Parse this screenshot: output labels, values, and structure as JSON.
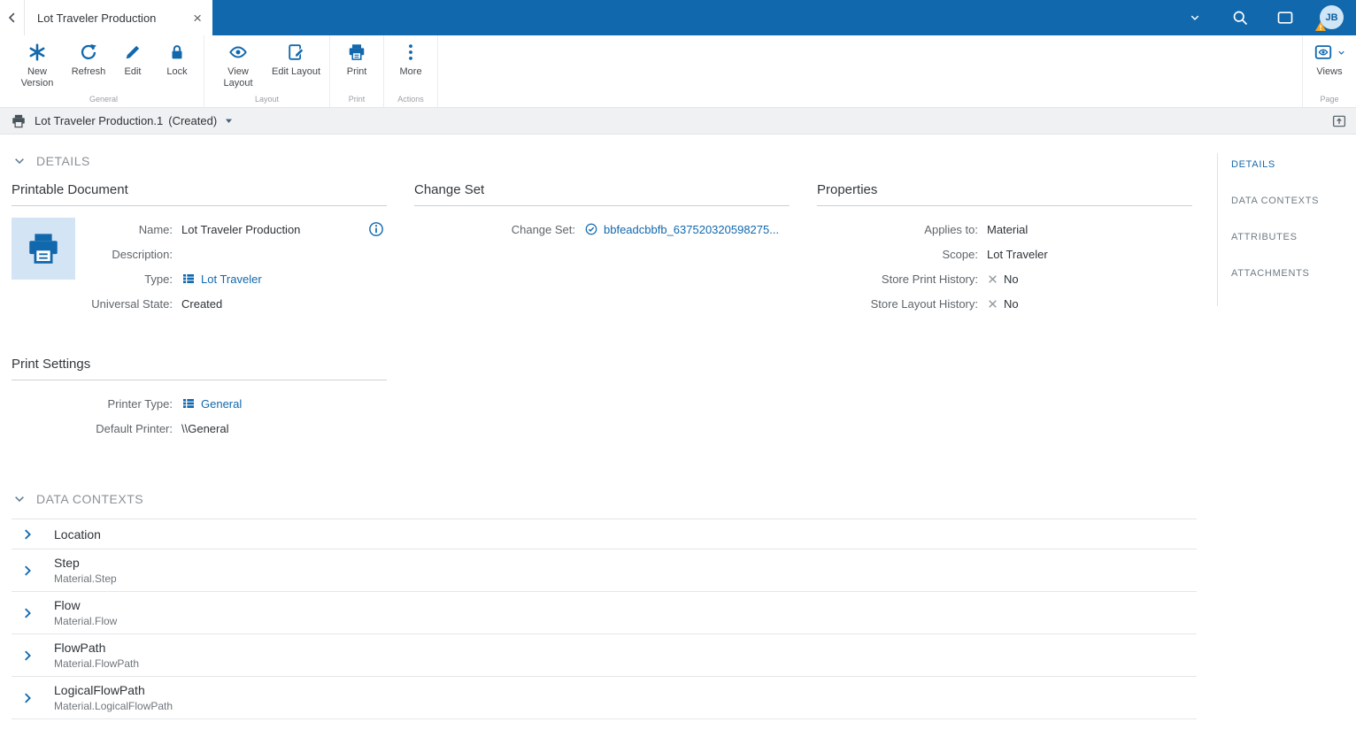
{
  "colors": {
    "accent": "#1168ad",
    "topbar": "#1168ad",
    "warning": "#f5a623"
  },
  "topbar": {
    "tab_title": "Lot Traveler Production",
    "avatar_initials": "JB"
  },
  "toolbar": {
    "groups": [
      {
        "label": "General",
        "buttons": [
          {
            "label": "New Version"
          },
          {
            "label": "Refresh"
          },
          {
            "label": "Edit"
          },
          {
            "label": "Lock"
          }
        ]
      },
      {
        "label": "Layout",
        "buttons": [
          {
            "label": "View Layout"
          },
          {
            "label": "Edit Layout"
          }
        ]
      },
      {
        "label": "Print",
        "buttons": [
          {
            "label": "Print"
          }
        ]
      },
      {
        "label": "Actions",
        "buttons": [
          {
            "label": "More"
          }
        ]
      }
    ],
    "page_group": {
      "label": "Page",
      "button_label": "Views"
    }
  },
  "subheader": {
    "title": "Lot Traveler Production.1",
    "state": "(Created)"
  },
  "right_nav": {
    "items": [
      {
        "label": "DETAILS",
        "active": true
      },
      {
        "label": "DATA CONTEXTS",
        "active": false
      },
      {
        "label": "ATTRIBUTES",
        "active": false
      },
      {
        "label": "ATTACHMENTS",
        "active": false
      }
    ]
  },
  "details": {
    "section_title": "DETAILS",
    "printable_document": {
      "title": "Printable Document",
      "name_label": "Name:",
      "name_value": "Lot Traveler Production",
      "description_label": "Description:",
      "description_value": "",
      "type_label": "Type:",
      "type_value": "Lot Traveler",
      "state_label": "Universal State:",
      "state_value": "Created"
    },
    "print_settings": {
      "title": "Print Settings",
      "printer_type_label": "Printer Type:",
      "printer_type_value": "General",
      "default_printer_label": "Default Printer:",
      "default_printer_value": "\\\\General"
    },
    "change_set": {
      "title": "Change Set",
      "label": "Change Set:",
      "value": "bbfeadcbbfb_637520320598275..."
    },
    "properties": {
      "title": "Properties",
      "fields": [
        {
          "label": "Applies to:",
          "value": "Material"
        },
        {
          "label": "Scope:",
          "value": "Lot Traveler"
        },
        {
          "label": "Store Print History:",
          "value": "No"
        },
        {
          "label": "Store Layout History:",
          "value": "No"
        }
      ]
    }
  },
  "data_contexts": {
    "section_title": "DATA CONTEXTS",
    "rows": [
      {
        "title": "Location",
        "subtitle": ""
      },
      {
        "title": "Step",
        "subtitle": "Material.Step"
      },
      {
        "title": "Flow",
        "subtitle": "Material.Flow"
      },
      {
        "title": "FlowPath",
        "subtitle": "Material.FlowPath"
      },
      {
        "title": "LogicalFlowPath",
        "subtitle": "Material.LogicalFlowPath"
      }
    ]
  }
}
